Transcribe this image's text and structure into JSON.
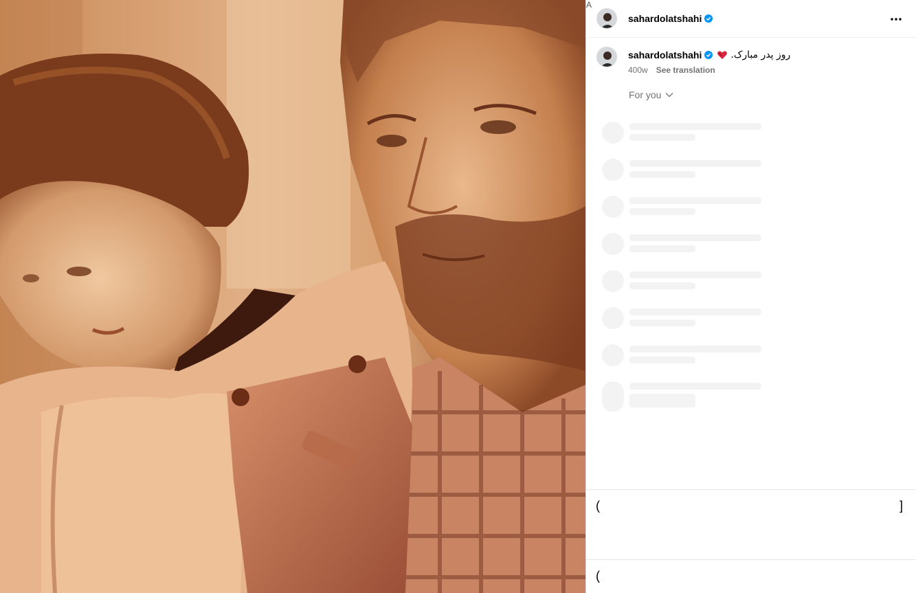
{
  "post": {
    "username": "sahardolatshahi",
    "verified": true,
    "caption": "روز پدر مبارک.",
    "age": "400w",
    "see_translation": "See translation",
    "sort_label": "For you",
    "icons": {
      "more": "more-horizontal-icon",
      "verified": "verified-badge-icon",
      "heart": "heart-emoji-icon",
      "chevron": "chevron-down-icon"
    },
    "colors": {
      "verified": "#0095f6",
      "skeleton": "#f3f3f3",
      "meta_text": "#737373"
    }
  }
}
